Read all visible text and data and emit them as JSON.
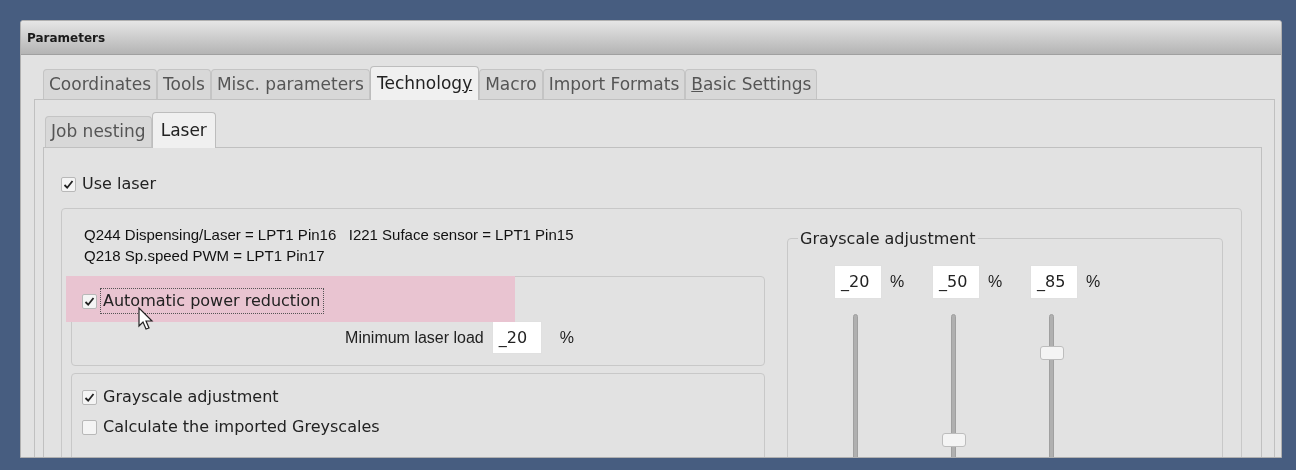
{
  "window": {
    "title": "Parameters"
  },
  "tabs": [
    {
      "label": "Coordinates",
      "selected": false
    },
    {
      "label": "Tools",
      "selected": false
    },
    {
      "label": "Misc. parameters",
      "selected": false
    },
    {
      "label_parts": [
        {
          "text": "Technolog",
          "underlined": false
        },
        {
          "text": "y",
          "underlined": true
        }
      ],
      "selected": true
    },
    {
      "label": "Macro",
      "selected": false
    },
    {
      "label": "Import Formats",
      "selected": false
    },
    {
      "label_parts": [
        {
          "text": "B",
          "underlined": true
        },
        {
          "text": "asic Settings",
          "underlined": false
        }
      ],
      "selected": false
    }
  ],
  "subtabs": [
    {
      "label": "Job nesting",
      "selected": false
    },
    {
      "label": "Laser",
      "selected": true
    }
  ],
  "use_laser": {
    "label": "Use laser",
    "checked": true
  },
  "io_info": [
    "Q244 Dispensing/Laser = LPT1 Pin16   I221 Suface sensor = LPT1 Pin15",
    "Q218 Sp.speed PWM = LPT1 Pin17"
  ],
  "power_reduction": {
    "label": "Automatic power reduction",
    "checked": true,
    "highlighted": true,
    "focused": true,
    "min_load_label": "Minimum laser load",
    "min_load_value": "_20",
    "unit": "%"
  },
  "grayscale_options": [
    {
      "label": "Grayscale adjustment",
      "checked": true
    },
    {
      "label": "Calculate the imported Greyscales",
      "checked": false
    }
  ],
  "grayscale_group": {
    "title": "Grayscale adjustment",
    "channels": [
      {
        "value": "_20",
        "unit": "%"
      },
      {
        "value": "_50",
        "unit": "%",
        "level": 0.5
      },
      {
        "value": "_85",
        "unit": "%",
        "level": 0.85
      }
    ]
  }
}
